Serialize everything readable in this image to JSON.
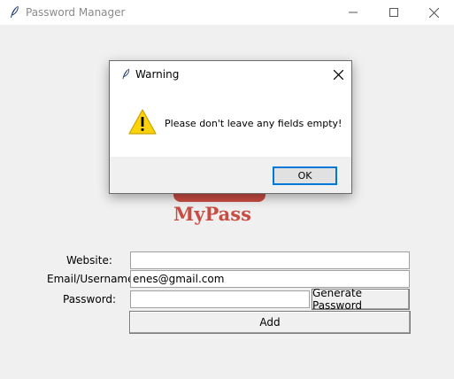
{
  "window": {
    "title": "Password Manager",
    "controls": {
      "minimize": "minimize-icon",
      "maximize": "maximize-icon",
      "close": "close-icon"
    }
  },
  "logo": {
    "text": "MyPass",
    "color": "#c94c43"
  },
  "form": {
    "website_label": "Website:",
    "website_value": "",
    "email_label": "Email/Username:",
    "email_value": "enes@gmail.com",
    "password_label": "Password:",
    "password_value": "",
    "generate_button": "Generate Password",
    "add_button": "Add"
  },
  "dialog": {
    "title": "Warning",
    "message": "Please don't leave any fields empty!",
    "ok_button": "OK",
    "icon": "warning-icon",
    "accent": "#0078d7"
  }
}
